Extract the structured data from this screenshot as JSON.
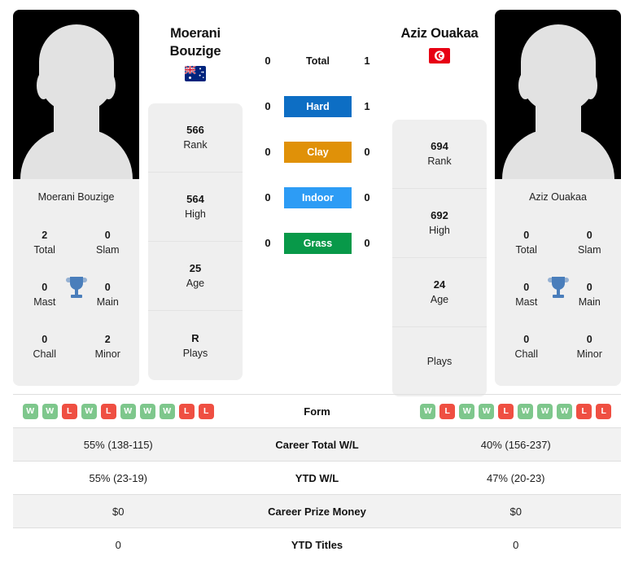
{
  "players": {
    "left": {
      "name": "Moerani Bouzige",
      "display_name_line1": "Moerani",
      "display_name_line2": "Bouzige",
      "flag": "australia-flag",
      "stats": [
        {
          "value": "566",
          "label": "Rank"
        },
        {
          "value": "564",
          "label": "High"
        },
        {
          "value": "25",
          "label": "Age"
        },
        {
          "value": "R",
          "label": "Plays"
        }
      ],
      "titles": [
        {
          "value": "2",
          "label": "Total"
        },
        {
          "value": "0",
          "label": "Slam"
        },
        {
          "value": "0",
          "label": "Mast"
        },
        {
          "value": "0",
          "label": "Main"
        },
        {
          "value": "0",
          "label": "Chall"
        },
        {
          "value": "2",
          "label": "Minor"
        }
      ],
      "form": [
        "W",
        "W",
        "L",
        "W",
        "L",
        "W",
        "W",
        "W",
        "L",
        "L"
      ],
      "career_total_wl": "55% (138-115)",
      "ytd_wl": "55% (23-19)",
      "career_prize_money": "$0",
      "ytd_titles": "0"
    },
    "right": {
      "name": "Aziz Ouakaa",
      "display_name_line1": "Aziz Ouakaa",
      "display_name_line2": "",
      "flag": "tunisia-flag",
      "stats": [
        {
          "value": "694",
          "label": "Rank"
        },
        {
          "value": "692",
          "label": "High"
        },
        {
          "value": "24",
          "label": "Age"
        },
        {
          "value": "",
          "label": "Plays"
        }
      ],
      "titles": [
        {
          "value": "0",
          "label": "Total"
        },
        {
          "value": "0",
          "label": "Slam"
        },
        {
          "value": "0",
          "label": "Mast"
        },
        {
          "value": "0",
          "label": "Main"
        },
        {
          "value": "0",
          "label": "Chall"
        },
        {
          "value": "0",
          "label": "Minor"
        }
      ],
      "form": [
        "W",
        "L",
        "W",
        "W",
        "L",
        "W",
        "W",
        "W",
        "L",
        "L"
      ],
      "career_total_wl": "40% (156-237)",
      "ytd_wl": "47% (20-23)",
      "career_prize_money": "$0",
      "ytd_titles": "0"
    }
  },
  "h2h": [
    {
      "label": "Total",
      "left": "0",
      "right": "1",
      "color": ""
    },
    {
      "label": "Hard",
      "left": "0",
      "right": "1",
      "color": "#0d6ec4"
    },
    {
      "label": "Clay",
      "left": "0",
      "right": "0",
      "color": "#e09108"
    },
    {
      "label": "Indoor",
      "left": "0",
      "right": "0",
      "color": "#2d9cf5"
    },
    {
      "label": "Grass",
      "left": "0",
      "right": "0",
      "color": "#089949"
    }
  ],
  "table": {
    "rows": [
      {
        "label": "Form",
        "type": "form"
      },
      {
        "label": "Career Total W/L",
        "type": "text",
        "key": "career_total_wl"
      },
      {
        "label": "YTD W/L",
        "type": "text",
        "key": "ytd_wl"
      },
      {
        "label": "Career Prize Money",
        "type": "text",
        "key": "career_prize_money"
      },
      {
        "label": "YTD Titles",
        "type": "text",
        "key": "ytd_titles"
      }
    ]
  },
  "colors": {
    "win_badge": "#7ec78c",
    "loss_badge": "#ef4f42",
    "card_bg": "#efefef",
    "trophy": "#4a7ebb",
    "shaded_row": "#f2f2f2"
  }
}
